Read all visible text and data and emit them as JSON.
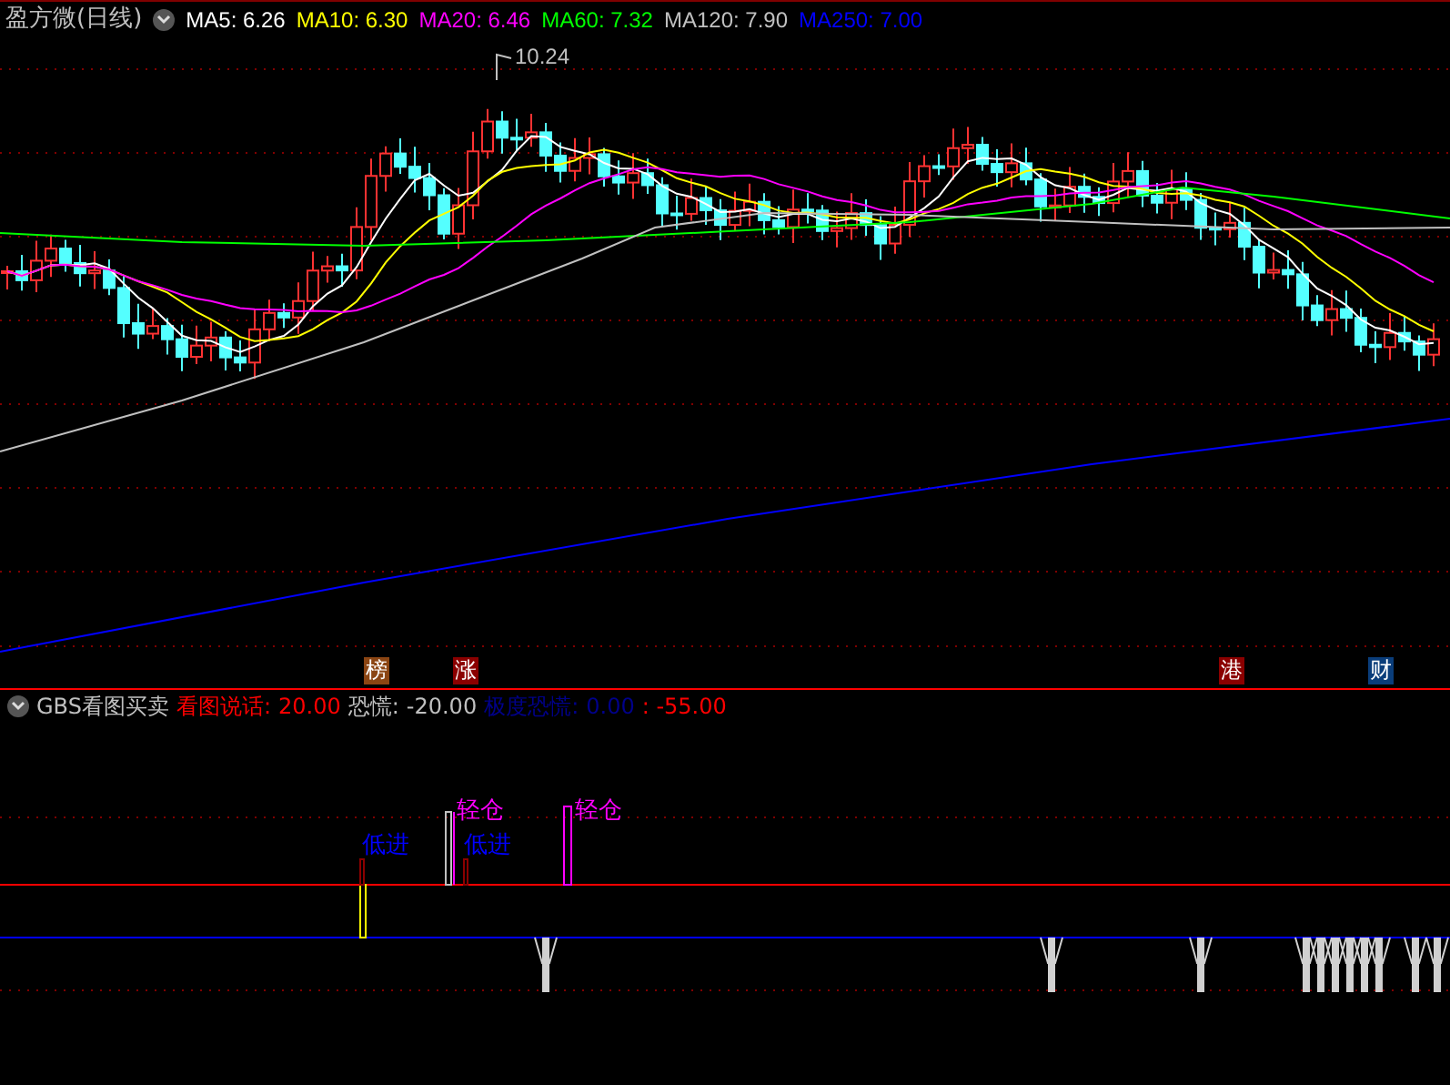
{
  "title": "盈方微(日线)",
  "ma_legend": [
    {
      "text": "MA5: 6.26",
      "color": "#ffffff"
    },
    {
      "text": "MA10: 6.30",
      "color": "#ffff00"
    },
    {
      "text": "MA20: 6.46",
      "color": "#ff00ff"
    },
    {
      "text": "MA60: 7.32",
      "color": "#00ff00"
    },
    {
      "text": "MA120: 7.90",
      "color": "#c0c0c0"
    },
    {
      "text": "MA250: 7.00",
      "color": "#0000ff"
    }
  ],
  "high_label": "10.24",
  "event_markers": [
    {
      "text": "榜",
      "color": "#8b4513"
    },
    {
      "text": "涨",
      "color": "#8b0000"
    },
    {
      "text": "港",
      "color": "#8b0000"
    },
    {
      "text": "财",
      "color": "#0a3d7a"
    }
  ],
  "indicator": {
    "name": "GBS看图买卖",
    "legend": [
      {
        "text": "看图说话:",
        "color": "#ff0000"
      },
      {
        "text": "20.00",
        "color": "#ff0000"
      },
      {
        "text": "恐慌:",
        "color": "#c0c0c0"
      },
      {
        "text": "-20.00",
        "color": "#c0c0c0"
      },
      {
        "text": "极度恐慌:",
        "color": "#00008b"
      },
      {
        "text": "0.00",
        "color": "#00008b"
      },
      {
        "text": ": -55.00",
        "color": "#ff0000"
      }
    ],
    "signals": [
      {
        "text": "低进",
        "color": "#0000ff"
      },
      {
        "text": "轻仓",
        "color": "#ff00ff"
      },
      {
        "text": "低进",
        "color": "#0000ff"
      },
      {
        "text": "轻仓",
        "color": "#ff00ff"
      }
    ]
  }
}
